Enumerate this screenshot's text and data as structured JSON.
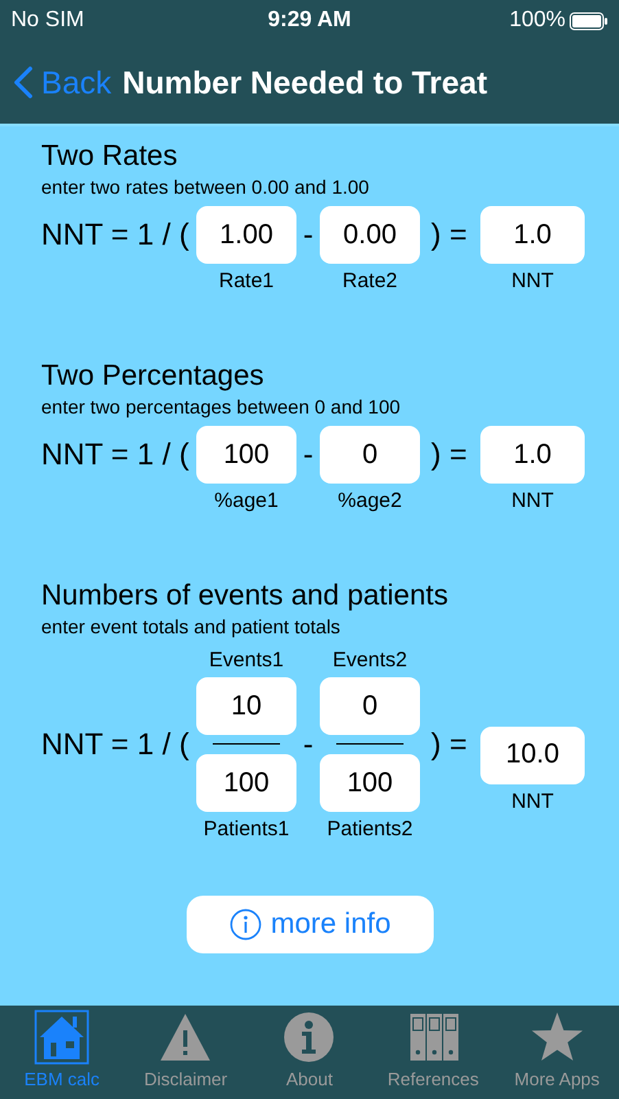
{
  "status_bar": {
    "carrier": "No SIM",
    "time": "9:29 AM",
    "battery": "100%"
  },
  "nav": {
    "back": "Back",
    "title": "Number Needed to Treat"
  },
  "sections": [
    {
      "kind": "simple",
      "title": "Two Rates",
      "hint": "enter two rates between 0.00 and 1.00",
      "prefix": "NNT = 1 / (",
      "operator": "-",
      "suffix": ") =",
      "inputs": [
        {
          "value": "1.00",
          "label": "Rate1"
        },
        {
          "value": "0.00",
          "label": "Rate2"
        }
      ],
      "result": {
        "value": "1.0",
        "label": "NNT"
      }
    },
    {
      "kind": "simple",
      "title": "Two Percentages",
      "hint": "enter two percentages between 0 and 100",
      "prefix": "NNT = 1 / (",
      "operator": "-",
      "suffix": ") =",
      "inputs": [
        {
          "value": "100",
          "label": "%age1"
        },
        {
          "value": "0",
          "label": "%age2"
        }
      ],
      "result": {
        "value": "1.0",
        "label": "NNT"
      }
    },
    {
      "kind": "fraction",
      "title": "Numbers of events and patients",
      "hint": "enter event totals and patient totals",
      "prefix": "NNT = 1 / (",
      "operator": "-",
      "suffix": ") =",
      "inputs": [
        {
          "numerator": {
            "value": "10",
            "label": "Events1"
          },
          "denominator": {
            "value": "100",
            "label": "Patients1"
          }
        },
        {
          "numerator": {
            "value": "0",
            "label": "Events2"
          },
          "denominator": {
            "value": "100",
            "label": "Patients2"
          }
        }
      ],
      "result": {
        "value": "10.0",
        "label": "NNT"
      }
    }
  ],
  "more_info": "more info",
  "tabs": [
    {
      "kind": "house",
      "label": "EBM calc",
      "selected": true
    },
    {
      "kind": "warning",
      "label": "Disclaimer",
      "selected": false
    },
    {
      "kind": "info",
      "label": "About",
      "selected": false
    },
    {
      "kind": "binders",
      "label": "References",
      "selected": false
    },
    {
      "kind": "star",
      "label": "More Apps",
      "selected": false
    }
  ]
}
